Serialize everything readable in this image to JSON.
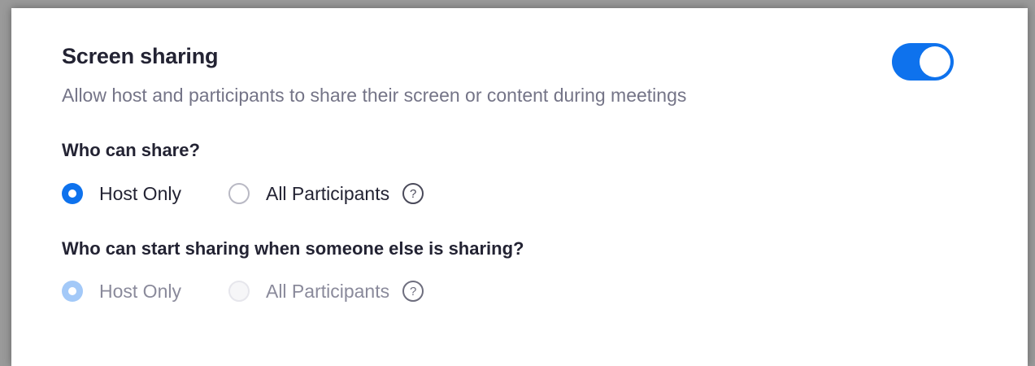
{
  "setting": {
    "title": "Screen sharing",
    "description": "Allow host and participants to share their screen or content during meetings",
    "enabled": true
  },
  "who_can_share": {
    "question": "Who can share?",
    "options": [
      "Host Only",
      "All Participants"
    ],
    "selected": "Host Only",
    "help_glyph": "?"
  },
  "who_can_start": {
    "question": "Who can start sharing when someone else is sharing?",
    "options": [
      "Host Only",
      "All Participants"
    ],
    "selected": "Host Only",
    "disabled": true,
    "help_glyph": "?"
  },
  "colors": {
    "accent": "#0e72ed",
    "accent_disabled": "#a3c9f8",
    "text_primary": "#232333",
    "text_secondary": "#747487"
  }
}
